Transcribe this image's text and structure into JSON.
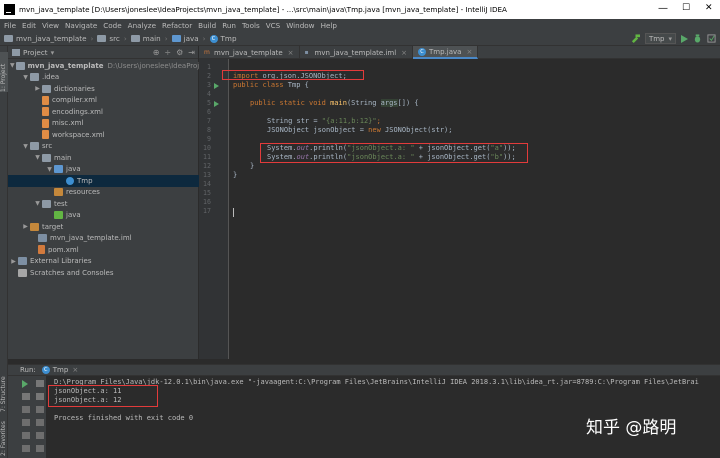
{
  "window": {
    "title": "mvn_java_template [D:\\Users\\joneslee\\IdeaProjects\\mvn_java_template] - ...\\src\\main\\java\\Tmp.java [mvn_java_template] - IntelliJ IDEA",
    "minimize": "—",
    "maximize": "☐",
    "close": "✕"
  },
  "menu": [
    "File",
    "Edit",
    "View",
    "Navigate",
    "Code",
    "Analyze",
    "Refactor",
    "Build",
    "Run",
    "Tools",
    "VCS",
    "Window",
    "Help"
  ],
  "breadcrumb": [
    "mvn_java_template",
    "src",
    "main",
    "java",
    "Tmp"
  ],
  "run_config": "Tmp",
  "project_panel": {
    "title": "Project",
    "tree": [
      {
        "label": "mvn_java_template",
        "extra": "D:\\Users\\joneslee\\IdeaProject"
      },
      {
        "label": ".idea"
      },
      {
        "label": "dictionaries"
      },
      {
        "label": "compiler.xml"
      },
      {
        "label": "encodings.xml"
      },
      {
        "label": "misc.xml"
      },
      {
        "label": "workspace.xml"
      },
      {
        "label": "src"
      },
      {
        "label": "main"
      },
      {
        "label": "java"
      },
      {
        "label": "Tmp"
      },
      {
        "label": "resources"
      },
      {
        "label": "test"
      },
      {
        "label": "java"
      },
      {
        "label": "target"
      },
      {
        "label": "mvn_java_template.iml"
      },
      {
        "label": "pom.xml"
      },
      {
        "label": "External Libraries"
      },
      {
        "label": "Scratches and Consoles"
      }
    ]
  },
  "side_labels": {
    "project": "1: Project",
    "structure": "7: Structure",
    "favorites": "2: Favorites"
  },
  "tabs": [
    {
      "label": "mvn_java_template"
    },
    {
      "label": "mvn_java_template.iml"
    },
    {
      "label": "Tmp.java"
    }
  ],
  "code": {
    "line_numbers": [
      "1",
      "2",
      "3",
      "4",
      "5",
      "6",
      "7",
      "8",
      "9",
      "10",
      "11",
      "12",
      "13",
      "14",
      "15",
      "16",
      "17"
    ],
    "import_kw": "import",
    "import_pkg": " org.json.JSONObject;",
    "class_decl_kw": "public class",
    "class_name": " Tmp {",
    "main_kw": "public static void",
    "main_name": "main",
    "main_params_a": "(String ",
    "main_params_b": "args",
    "main_params_c": "[]) {",
    "str_decl": "String str = ",
    "str_val": "\"{a:11,b:12}\"",
    "semi": ";",
    "json_decl": "JSONObject jsonObject = ",
    "new_kw": "new",
    "json_ctor": " JSONObject(str);",
    "sys_a": "System.",
    "out": "out",
    "println_a": ".println(",
    "str_a": "\"jsonObject.a: \"",
    "get_a": " + jsonObject.get(",
    "key_a": "\"a\"",
    "close": "));",
    "str_b": "\"jsonObject.a: \"",
    "key_b": "\"b\"",
    "brace_close": "}",
    "class_close": "}"
  },
  "run_panel": {
    "label": "Run:",
    "tab": "Tmp",
    "command": "D:\\Program Files\\Java\\jdk-12.0.1\\bin\\java.exe \"-javaagent:C:\\Program Files\\JetBrains\\IntelliJ IDEA 2018.3.1\\lib\\idea_rt.jar=8789:C:\\Program Files\\JetBrai",
    "output": [
      "jsonObject.a: 11",
      "jsonObject.a: 12"
    ],
    "exit": "Process finished with exit code 0"
  },
  "watermark": "知乎 @路明"
}
